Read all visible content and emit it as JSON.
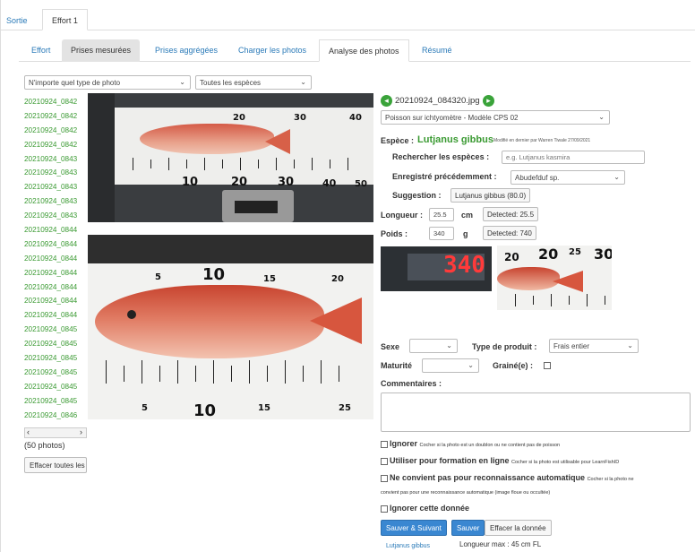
{
  "top_tabs": {
    "sortie": "Sortie",
    "effort": "Effort 1"
  },
  "sub_tabs": [
    "Effort",
    "Prises mesurées",
    "Prises aggrégées",
    "Charger les photos",
    "Analyse des photos",
    "Résumé"
  ],
  "filters": {
    "photo_type": "N'importe quel type de photo",
    "species": "Toutes les espèces"
  },
  "files": [
    "20210924_0842",
    "20210924_0842",
    "20210924_0842",
    "20210924_0842",
    "20210924_0843",
    "20210924_0843",
    "20210924_0843",
    "20210924_0843",
    "20210924_0843",
    "20210924_0844",
    "20210924_0844",
    "20210924_0844",
    "20210924_0844",
    "20210924_0844",
    "20210924_0844",
    "20210924_0844",
    "20210924_0845",
    "20210924_0845",
    "20210924_0845",
    "20210924_0845",
    "20210924_0845",
    "20210924_0845",
    "20210924_0846"
  ],
  "photo_count": "(50 photos)",
  "clear_all_button": "Effacer toutes les",
  "photo": {
    "filename": "20210924_084320.jpg",
    "photo_type": "Poisson sur ichtyomètre - Modèle CPS 02"
  },
  "ruler1_numbers": [
    "10",
    "20",
    "30",
    "40",
    "50"
  ],
  "ruler1_top_numbers": [
    "20",
    "30",
    "40"
  ],
  "ruler2_numbers": [
    "5",
    "10",
    "15",
    "20",
    "25"
  ],
  "scale_display": "340",
  "crop_numbers": [
    "20",
    "25",
    "30"
  ],
  "species": {
    "label": "Espèce :",
    "name": "Lutjanus gibbus",
    "modified": "Modifié en dernier par Warren Tiwale 27/09/2021",
    "search_label": "Rechercher les espèces :",
    "search_placeholder": "e.g. Lutjanus kasmira",
    "recorded_label": "Enregistré précédemment :",
    "recorded_value": "Abudefduf sp.",
    "suggestion_label": "Suggestion :",
    "suggestion_value": "Lutjanus gibbus (80.0)"
  },
  "length": {
    "label": "Longueur :",
    "value": "25.5",
    "unit": "cm",
    "detected": "Detected: 25.5"
  },
  "weight": {
    "label": "Poids :",
    "value": "340",
    "unit": "g",
    "detected": "Detected: 740"
  },
  "sex_label": "Sexe",
  "product_label": "Type de produit :",
  "product_value": "Frais entier",
  "maturity_label": "Maturité",
  "grain_label": "Grainé(e) :",
  "comments_label": "Commentaires :",
  "checks": {
    "ignore_bold": "Ignorer",
    "ignore_text": "Cocher si la photo est un doublon ou ne contient pas de poisson",
    "training_bold": "Utiliser pour formation en ligne",
    "training_text": "Cocher si la photo est utilisable pour LearnFishID",
    "noauto_bold": "Ne convient pas pour reconnaissance automatique",
    "noauto_text": "Cocher si la photo ne",
    "noauto_text2": "convient pas pour une reconnaissance automatique (image floue ou occultée)",
    "ignore_data": "Ignorer cette donnée"
  },
  "buttons": {
    "save_next": "Sauver & Suivant",
    "save": "Sauver",
    "clear": "Effacer la donnée"
  },
  "footer": {
    "species_link": "Lutjanus gibbus",
    "max_length": "Longueur max : 45 cm FL"
  }
}
